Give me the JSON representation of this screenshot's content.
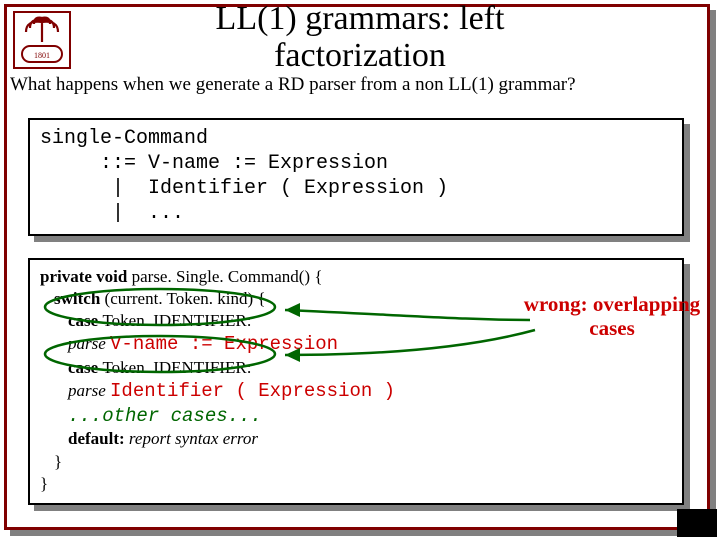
{
  "title_line1": "LL(1) grammars: left",
  "title_line2": "factorization",
  "subtitle": "What happens when we generate a RD parser from a non LL(1) grammar?",
  "grammar": {
    "l1": "single-Command",
    "l2": "     ::= V-name := Expression",
    "l3": "      |  Identifier ( Expression )",
    "l4": "      |  ..."
  },
  "code": {
    "l1a": "private void ",
    "l1b": "parse. Single. Command() {",
    "l2a": "switch ",
    "l2b": "(current. Token. kind) {",
    "l3a": "case ",
    "l3b": "Token. IDENTIFIER:",
    "l4a": "parse ",
    "l4b": "V-name := Expression",
    "l5a": "case ",
    "l5b": "Token. IDENTIFIER:",
    "l6a": "parse ",
    "l6b": "Identifier ( Expression )",
    "l7": "...other cases...",
    "l8a": "default: ",
    "l8b": "report syntax error",
    "l9": "}",
    "l10": "}"
  },
  "callout_l1": "wrong: overlapping",
  "callout_l2": "cases"
}
